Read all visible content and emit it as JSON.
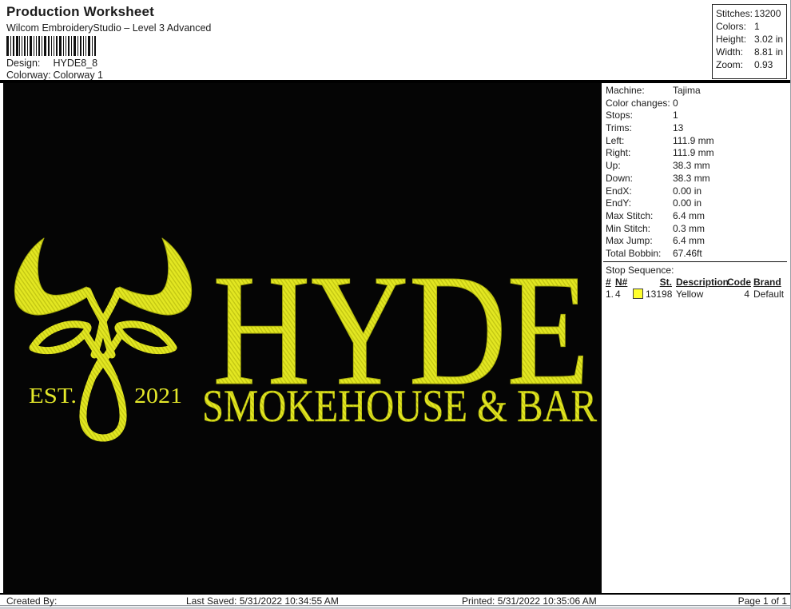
{
  "header": {
    "title": "Production Worksheet",
    "subtitle": "Wilcom EmbroideryStudio – Level 3 Advanced",
    "design_label": "Design:",
    "design_value": "HYDE8_8",
    "colorway_label": "Colorway:",
    "colorway_value": "Colorway 1",
    "stats": {
      "stitches_label": "Stitches:",
      "stitches": "13200",
      "colors_label": "Colors:",
      "colors": "1",
      "height_label": "Height:",
      "height": "3.02 in",
      "width_label": "Width:",
      "width": "8.81 in",
      "zoom_label": "Zoom:",
      "zoom": "0.93"
    }
  },
  "machine": {
    "rows": [
      {
        "label": "Machine:",
        "value": "Tajima"
      },
      {
        "label": "Color changes:",
        "value": "0"
      },
      {
        "label": "Stops:",
        "value": "1"
      },
      {
        "label": "Trims:",
        "value": "13"
      },
      {
        "label": "Left:",
        "value": "111.9 mm"
      },
      {
        "label": "Right:",
        "value": "111.9 mm"
      },
      {
        "label": "Up:",
        "value": "38.3 mm"
      },
      {
        "label": "Down:",
        "value": "38.3 mm"
      },
      {
        "label": "EndX:",
        "value": "0.00 in"
      },
      {
        "label": "EndY:",
        "value": "0.00 in"
      },
      {
        "label": "Max Stitch:",
        "value": "6.4 mm"
      },
      {
        "label": "Min Stitch:",
        "value": "0.3 mm"
      },
      {
        "label": "Max Jump:",
        "value": "6.4 mm"
      },
      {
        "label": "Total Bobbin:",
        "value": "67.46ft"
      }
    ]
  },
  "stop_sequence": {
    "title": "Stop Sequence:",
    "columns": [
      "#",
      "N#",
      "St.",
      "Description",
      "Code",
      "Brand"
    ],
    "rows": [
      {
        "num": "1.",
        "n": "4",
        "swatch_color": "#ffff2e",
        "st": "13198",
        "description": "Yellow",
        "code": "4",
        "brand": "Default"
      }
    ]
  },
  "design": {
    "name_text": "HYDE",
    "tagline_text": "SMOKEHOUSE & BAR",
    "est_text": "EST.",
    "year_text": "2021",
    "thread_color": "#e3e722",
    "thread_shade": "#c3c713",
    "background_color": "#050505"
  },
  "footer": {
    "created_by_label": "Created By:",
    "last_saved": "Last Saved: 5/31/2022 10:34:55 AM",
    "printed": "Printed: 5/31/2022 10:35:06 AM",
    "page": "Page 1 of 1"
  }
}
